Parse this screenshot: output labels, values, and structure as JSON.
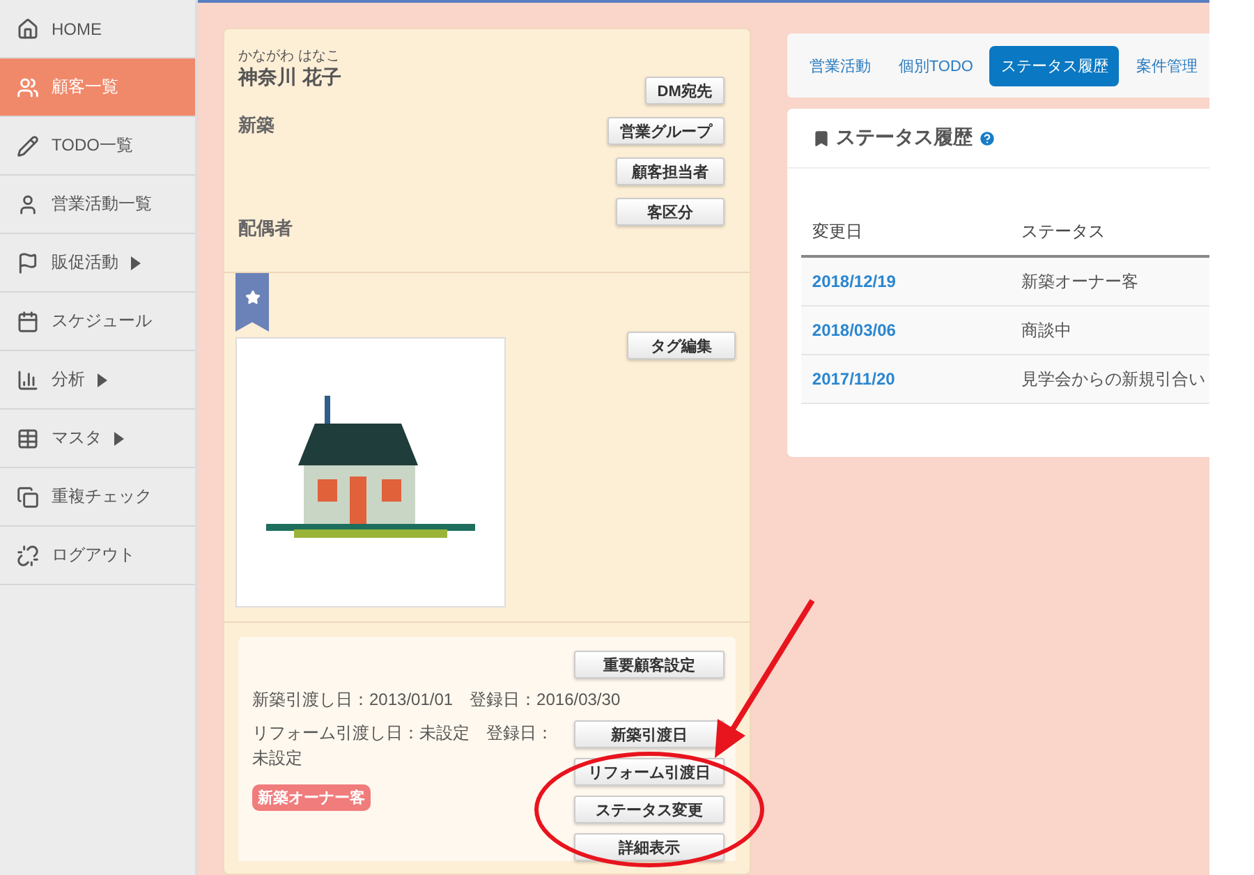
{
  "sidebar": {
    "items": [
      {
        "label": "HOME",
        "submenu": false,
        "selected": false
      },
      {
        "label": "顧客一覧",
        "submenu": false,
        "selected": true
      },
      {
        "label": "TODO一覧",
        "submenu": false,
        "selected": false
      },
      {
        "label": "営業活動一覧",
        "submenu": false,
        "selected": false
      },
      {
        "label": "販促活動",
        "submenu": true,
        "selected": false
      },
      {
        "label": "スケジュール",
        "submenu": false,
        "selected": false
      },
      {
        "label": "分析",
        "submenu": true,
        "selected": false
      },
      {
        "label": "マスタ",
        "submenu": true,
        "selected": false
      },
      {
        "label": "重複チェック",
        "submenu": false,
        "selected": false
      },
      {
        "label": "ログアウト",
        "submenu": false,
        "selected": false
      }
    ]
  },
  "customer": {
    "kana": "かながわ はなこ",
    "name": "神奈川 花子",
    "category": "新築",
    "spouse_label": "配偶者",
    "buttons": [
      "DM宛先",
      "営業グループ",
      "顧客担当者",
      "客区分"
    ]
  },
  "favorite": {
    "starred": true
  },
  "tag_button": "タグ編集",
  "details": {
    "important_button": "重要顧客設定",
    "new_build_line": "新築引渡し日：2013/01/01　登録日：2016/03/30",
    "reform_line": "リフォーム引渡し日：未設定　登録日：未設定",
    "status_badge": "新築オーナー客",
    "buttons": [
      "新築引渡日",
      "リフォーム引渡日",
      "ステータス変更",
      "詳細表示"
    ]
  },
  "tabs": [
    {
      "label": "営業活動",
      "selected": false
    },
    {
      "label": "個別TODO",
      "selected": false
    },
    {
      "label": "ステータス履歴",
      "selected": true
    },
    {
      "label": "案件管理",
      "selected": false
    }
  ],
  "status_panel": {
    "title": "ステータス履歴",
    "columns": [
      "変更日",
      "ステータス"
    ],
    "rows": [
      {
        "date": "2018/12/19",
        "status": "新築オーナー客"
      },
      {
        "date": "2018/03/06",
        "status": "商談中"
      },
      {
        "date": "2017/11/20",
        "status": "見学会からの新規引合い"
      }
    ]
  }
}
